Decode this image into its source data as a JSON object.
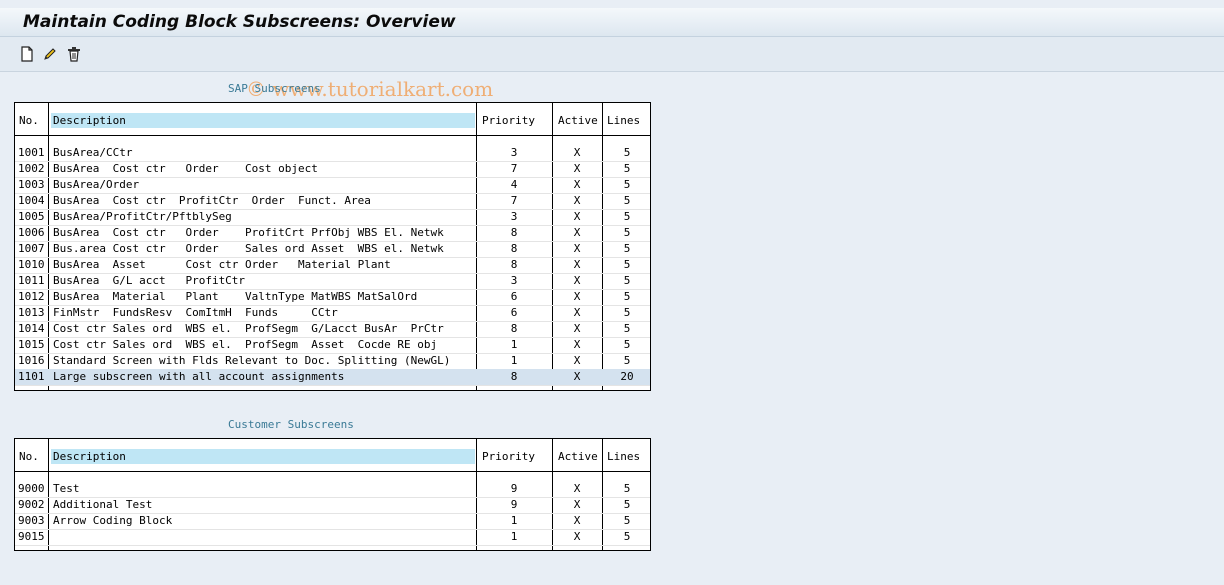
{
  "title": "Maintain Coding Block Subscreens: Overview",
  "watermark": "© www.tutorialkart.com",
  "toolbar": {
    "buttons": [
      {
        "name": "new-entries-button",
        "icon": "new-document-icon"
      },
      {
        "name": "change-button",
        "icon": "pencil-icon"
      },
      {
        "name": "delete-button",
        "icon": "trash-icon"
      }
    ]
  },
  "sap_section": {
    "title": "SAP Subscreens",
    "headers": {
      "no": "No.",
      "description": "Description",
      "priority": "Priority",
      "active": "Active",
      "lines": "Lines"
    },
    "rows": [
      {
        "no": "1001",
        "description": "BusArea/CCtr",
        "priority": "3",
        "active": "X",
        "lines": "5"
      },
      {
        "no": "1002",
        "description": "BusArea  Cost ctr   Order    Cost object",
        "priority": "7",
        "active": "X",
        "lines": "5"
      },
      {
        "no": "1003",
        "description": "BusArea/Order",
        "priority": "4",
        "active": "X",
        "lines": "5"
      },
      {
        "no": "1004",
        "description": "BusArea  Cost ctr  ProfitCtr  Order  Funct. Area",
        "priority": "7",
        "active": "X",
        "lines": "5"
      },
      {
        "no": "1005",
        "description": "BusArea/ProfitCtr/PftblySeg",
        "priority": "3",
        "active": "X",
        "lines": "5"
      },
      {
        "no": "1006",
        "description": "BusArea  Cost ctr   Order    ProfitCrt PrfObj WBS El. Netwk",
        "priority": "8",
        "active": "X",
        "lines": "5"
      },
      {
        "no": "1007",
        "description": "Bus.area Cost ctr   Order    Sales ord Asset  WBS el. Netwk",
        "priority": "8",
        "active": "X",
        "lines": "5"
      },
      {
        "no": "1010",
        "description": "BusArea  Asset      Cost ctr Order   Material Plant",
        "priority": "8",
        "active": "X",
        "lines": "5"
      },
      {
        "no": "1011",
        "description": "BusArea  G/L acct   ProfitCtr",
        "priority": "3",
        "active": "X",
        "lines": "5"
      },
      {
        "no": "1012",
        "description": "BusArea  Material   Plant    ValtnType MatWBS MatSalOrd",
        "priority": "6",
        "active": "X",
        "lines": "5"
      },
      {
        "no": "1013",
        "description": "FinMstr  FundsResv  ComItmH  Funds     CCtr",
        "priority": "6",
        "active": "X",
        "lines": "5"
      },
      {
        "no": "1014",
        "description": "Cost ctr Sales ord  WBS el.  ProfSegm  G/Lacct BusAr  PrCtr",
        "priority": "8",
        "active": "X",
        "lines": "5"
      },
      {
        "no": "1015",
        "description": "Cost ctr Sales ord  WBS el.  ProfSegm  Asset  Cocde RE obj",
        "priority": "1",
        "active": "X",
        "lines": "5"
      },
      {
        "no": "1016",
        "description": "Standard Screen with Flds Relevant to Doc. Splitting (NewGL)",
        "priority": "1",
        "active": "X",
        "lines": "5"
      },
      {
        "no": "1101",
        "description": "Large subscreen with all account assignments",
        "priority": "8",
        "active": "X",
        "lines": "20"
      }
    ]
  },
  "customer_section": {
    "title": "Customer Subscreens",
    "headers": {
      "no": "No.",
      "description": "Description",
      "priority": "Priority",
      "active": "Active",
      "lines": "Lines"
    },
    "rows": [
      {
        "no": "9000",
        "description": "Test",
        "priority": "9",
        "active": "X",
        "lines": "5"
      },
      {
        "no": "9002",
        "description": "Additional Test",
        "priority": "9",
        "active": "X",
        "lines": "5"
      },
      {
        "no": "9003",
        "description": "Arrow Coding Block",
        "priority": "1",
        "active": "X",
        "lines": "5"
      },
      {
        "no": "9015",
        "description": "",
        "priority": "1",
        "active": "X",
        "lines": "5"
      }
    ]
  }
}
